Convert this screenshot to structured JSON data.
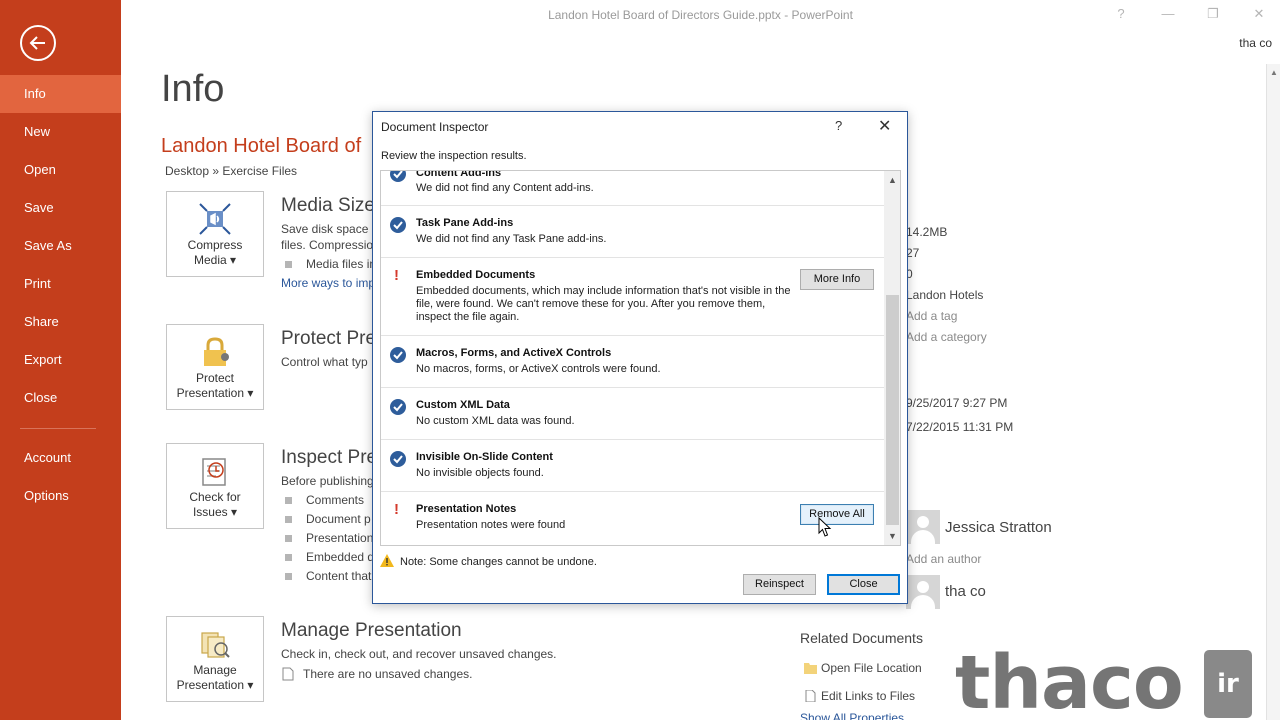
{
  "window": {
    "title": "Landon Hotel Board of Directors Guide.pptx - PowerPoint",
    "help_glyph": "?",
    "minimize_glyph": "—",
    "restore_glyph": "❐",
    "close_glyph": "✕",
    "user": "tha co"
  },
  "nav": {
    "items": [
      "Info",
      "New",
      "Open",
      "Save",
      "Save As",
      "Print",
      "Share",
      "Export",
      "Close",
      "Account",
      "Options"
    ],
    "active": "Info",
    "accent_color": "#c43e1c"
  },
  "info": {
    "heading": "Info",
    "doc_title": "Landon Hotel Board of",
    "path": "Desktop » Exercise Files",
    "media": {
      "button": [
        "Compress",
        "Media ▾"
      ],
      "title": "Media Size",
      "lines": [
        "Save disk space a",
        "files. Compressio"
      ],
      "bullets": [
        "Media files in"
      ],
      "link": "More ways to imp"
    },
    "protect": {
      "button": [
        "Protect",
        "Presentation ▾"
      ],
      "title": "Protect Pres",
      "lines": [
        "Control what typ"
      ]
    },
    "inspect": {
      "button": [
        "Check for",
        "Issues ▾"
      ],
      "title": "Inspect Pre",
      "lines": [
        "Before publishing"
      ],
      "bullets": [
        "Comments",
        "Document p",
        "Presentation",
        "Embedded d",
        "Content that"
      ]
    },
    "manage": {
      "button": [
        "Manage",
        "Presentation ▾"
      ],
      "title": "Manage Presentation",
      "lines": [
        "Check in, check out, and recover unsaved changes."
      ],
      "note": "There are no unsaved changes."
    }
  },
  "properties": {
    "values": [
      "14.2MB",
      "27",
      "0",
      "Landon Hotels"
    ],
    "add_tag": "Add a tag",
    "add_category": "Add a category",
    "dates": [
      "9/25/2017 9:27 PM",
      "7/22/2015 11:31 PM"
    ],
    "authors": [
      "Jessica Stratton",
      "tha co"
    ],
    "add_author": "Add an author",
    "related_heading": "Related Documents",
    "related_links": [
      "Open File Location",
      "Edit Links to Files",
      "Show All Properties"
    ]
  },
  "dialog": {
    "title": "Document Inspector",
    "help": "?",
    "close_glyph": "✕",
    "subtitle": "Review the inspection results.",
    "results": [
      {
        "status": "ok",
        "title": "Content Add-ins",
        "desc": "We did not find any Content add-ins.",
        "button": ""
      },
      {
        "status": "ok",
        "title": "Task Pane Add-ins",
        "desc": "We did not find any Task Pane add-ins.",
        "button": ""
      },
      {
        "status": "warn",
        "title": "Embedded Documents",
        "desc": "Embedded documents, which may include information that's not visible in the file, were found. We can't remove these for you. After you remove them, inspect the file again.",
        "button": "More Info"
      },
      {
        "status": "ok",
        "title": "Macros, Forms, and ActiveX Controls",
        "desc": "No macros, forms, or ActiveX controls were found.",
        "button": ""
      },
      {
        "status": "ok",
        "title": "Custom XML Data",
        "desc": "No custom XML data was found.",
        "button": ""
      },
      {
        "status": "ok",
        "title": "Invisible On-Slide Content",
        "desc": "No invisible objects found.",
        "button": ""
      },
      {
        "status": "warn",
        "title": "Presentation Notes",
        "desc": "Presentation notes were found",
        "button": "Remove All"
      }
    ],
    "note": "Note: Some changes cannot be undone.",
    "reinspect_label": "Reinspect",
    "close_label": "Close"
  },
  "watermark": {
    "text": "thaco",
    "badge": "ir"
  }
}
